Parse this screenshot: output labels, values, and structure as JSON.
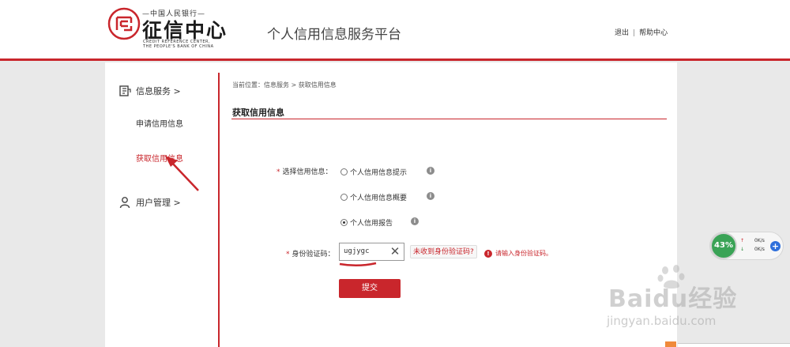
{
  "header": {
    "logo_sub": "—中国人民银行—",
    "logo_main": "征信中心",
    "logo_en_line1": "CREDIT REFERENCE CENTER,",
    "logo_en_line2": "THE PEOPLE'S BANK OF CHINA",
    "platform_title": "个人信用信息服务平台",
    "logout": "退出",
    "link_separator": "|",
    "help": "帮助中心"
  },
  "sidebar": {
    "credit_service": "信息服务 >",
    "apply_credit": "申请信用信息",
    "get_credit": "获取信用信息",
    "user_manage": "用户管理 >"
  },
  "main": {
    "breadcrumb": "当前位置：信息服务 > 获取信用信息",
    "section_title": "获取信用信息",
    "select_label": "选择信用信息：",
    "required_mark": "*",
    "options": [
      {
        "label": "个人信用信息提示",
        "checked": false
      },
      {
        "label": "个人信用信息概要",
        "checked": false
      },
      {
        "label": "个人信用报告",
        "checked": true
      }
    ],
    "code_label": "身份验证码：",
    "code_value": "ugjygc",
    "not_received": "未收到身份验证码?",
    "error_text": "请输入身份验证码。",
    "submit": "提交"
  },
  "net_widget": {
    "percent": "43%",
    "up_value": "0K/s",
    "down_value": "0K/s"
  },
  "watermark": {
    "main": "Baidu经验",
    "sub": "jingyan.baidu.com"
  },
  "colors": {
    "brand_red": "#c9262c",
    "widget_green": "#3aa356",
    "widget_blue": "#2e6fdb"
  }
}
